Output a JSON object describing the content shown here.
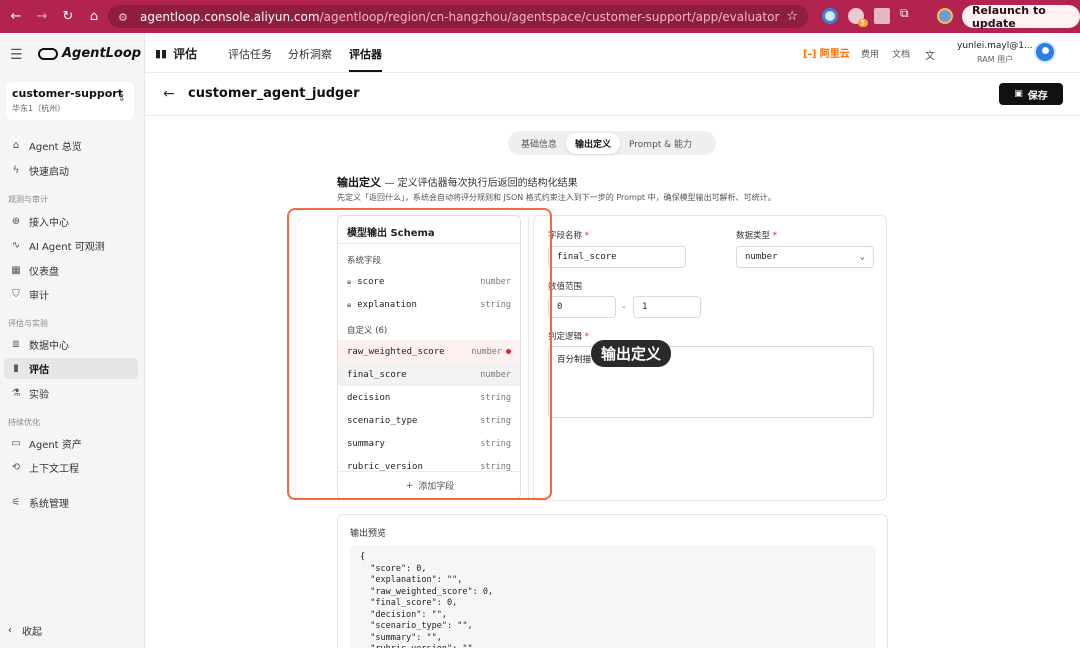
{
  "browser": {
    "url_host": "agentloop.console.aliyun.com",
    "url_path": "/agentloop/region/cn-hangzhou/agentspace/customer-support/app/evaluator",
    "relaunch_label": "Relaunch to update",
    "ext_badge": "5"
  },
  "sidebar": {
    "brand": "AgentLoop",
    "workspace_name": "customer-support",
    "workspace_region": "华东1（杭州）",
    "items": [
      {
        "label": "Agent 总览",
        "icon": "home-icon"
      },
      {
        "label": "快速启动",
        "icon": "bolt-icon"
      },
      {
        "label": "接入中心",
        "icon": "plug-icon"
      },
      {
        "label": "AI Agent 可观测",
        "icon": "pulse-icon"
      },
      {
        "label": "仪表盘",
        "icon": "dashboard-icon"
      },
      {
        "label": "审计",
        "icon": "shield-icon"
      },
      {
        "label": "数据中心",
        "icon": "database-icon"
      },
      {
        "label": "评估",
        "icon": "bar-chart-icon"
      },
      {
        "label": "实验",
        "icon": "flask-icon"
      },
      {
        "label": "Agent 资产",
        "icon": "folder-icon"
      },
      {
        "label": "上下文工程",
        "icon": "context-icon"
      },
      {
        "label": "系统管理",
        "icon": "sliders-icon"
      }
    ],
    "groups": [
      "观测与审计",
      "评估与实验",
      "持续优化"
    ],
    "collapse_label": "收起"
  },
  "header": {
    "module": "评估",
    "tabs": [
      "评估任务",
      "分析洞察",
      "评估器"
    ],
    "active_tab": "评估器",
    "aliyun": "阿里云",
    "links": [
      "费用",
      "文档"
    ],
    "user_name": "yunlei.mayl@1...",
    "user_role": "RAM 用户"
  },
  "page": {
    "title": "customer_agent_judger",
    "save_label": "保存",
    "segments": [
      "基础信息",
      "输出定义",
      "Prompt & 能力"
    ],
    "active_segment": "输出定义",
    "section_title": "输出定义",
    "section_subtitle": "— 定义评估器每次执行后返回的结构化结果",
    "section_desc": "先定义「返回什么」，系统会自动将评分规则和 JSON 格式约束注入到下一步的 Prompt 中，确保模型输出可解析、可统计。"
  },
  "schema": {
    "title": "模型输出 Schema",
    "system_group": "系统字段",
    "system_fields": [
      {
        "name": "score",
        "type": "number"
      },
      {
        "name": "explanation",
        "type": "string"
      }
    ],
    "custom_group": "自定义 (6)",
    "custom_fields": [
      {
        "name": "raw_weighted_score",
        "type": "number"
      },
      {
        "name": "final_score",
        "type": "number"
      },
      {
        "name": "decision",
        "type": "string"
      },
      {
        "name": "scenario_type",
        "type": "string"
      },
      {
        "name": "summary",
        "type": "string"
      },
      {
        "name": "rubric_version",
        "type": "string"
      }
    ],
    "add_label": "添加字段"
  },
  "editor": {
    "field_name_label": "字段名称",
    "field_name_value": "final_score",
    "data_type_label": "数据类型",
    "data_type_value": "number",
    "range_label": "数值范围",
    "range_min": "0",
    "range_sep": "-",
    "range_max": "1",
    "logic_label": "判定逻辑",
    "logic_value": "百分制描"
  },
  "tooltip": "输出定义",
  "preview": {
    "title": "输出预览",
    "code": "{\n  \"score\": 0,\n  \"explanation\": \"\",\n  \"raw_weighted_score\": 0,\n  \"final_score\": 0,\n  \"decision\": \"\",\n  \"scenario_type\": \"\",\n  \"summary\": \"\",\n  \"rubric_version\": \"\""
  },
  "colors": {
    "chrome": "#b2244f",
    "highlight": "#f26a3a",
    "required": "#e0242f",
    "aliyun": "#ff6a00"
  }
}
